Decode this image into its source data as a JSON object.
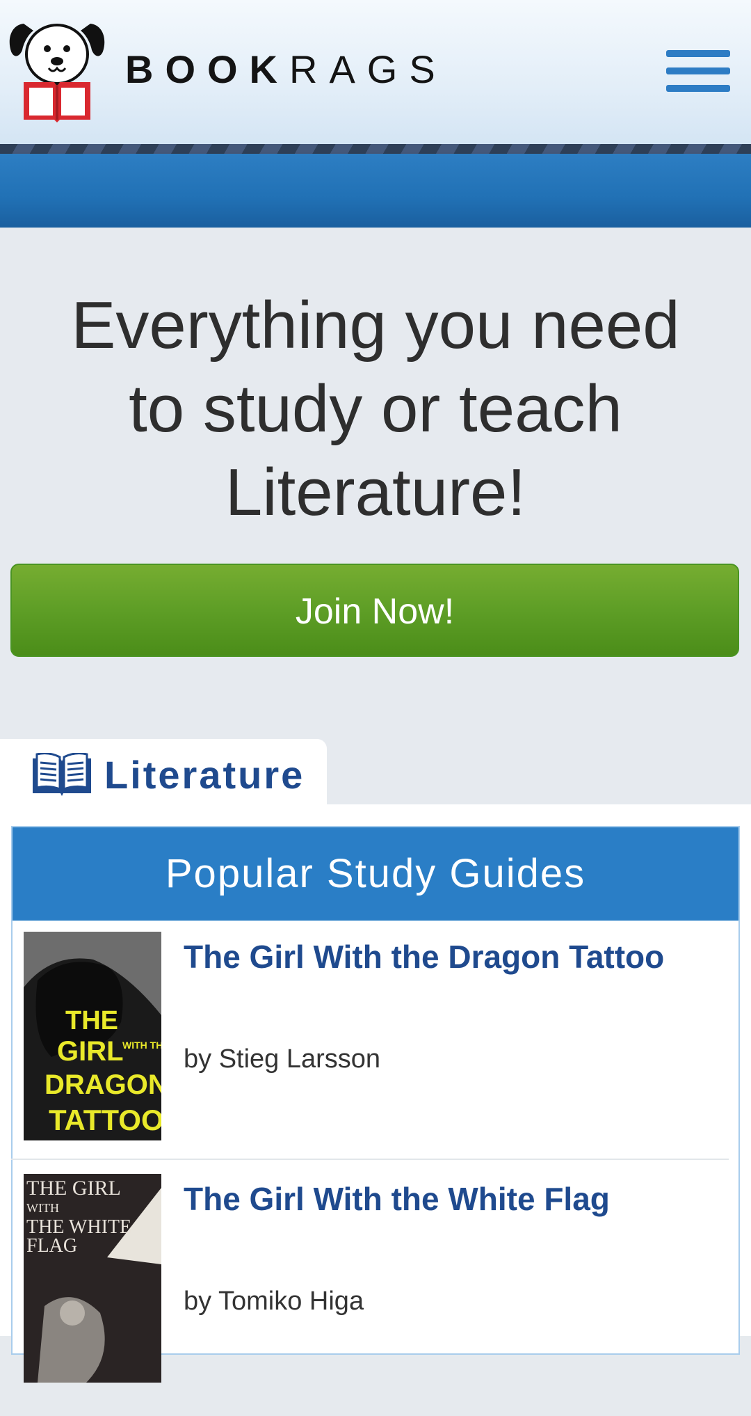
{
  "header": {
    "brand_bold": "BOOK",
    "brand_light": "RAGS",
    "logo_icon": "dog-holding-book-logo",
    "menu_icon": "hamburger-menu-icon"
  },
  "hero": {
    "line1": "Everything you need",
    "line2": "to study or teach",
    "line3": "Literature!",
    "join_label": "Join Now!"
  },
  "tab": {
    "label": "Literature",
    "icon": "open-book-icon"
  },
  "guides": {
    "heading": "Popular Study Guides",
    "items": [
      {
        "title": "The Girl With the Dragon Tattoo",
        "author": "by Stieg Larsson",
        "cover_text": [
          "THE",
          "GIRL",
          "WITH THE",
          "DRAGON",
          "TATTOO"
        ]
      },
      {
        "title": "The Girl With the White Flag",
        "author": "by Tomiko Higa",
        "cover_text": [
          "THE GIRL",
          "WITH",
          "THE WHITE",
          "FLAG"
        ]
      }
    ]
  },
  "colors": {
    "brand_blue": "#2a7ec6",
    "link_blue": "#1f4a8e",
    "join_green": "#5e9e26",
    "menu_blue": "#2d7cc4"
  }
}
